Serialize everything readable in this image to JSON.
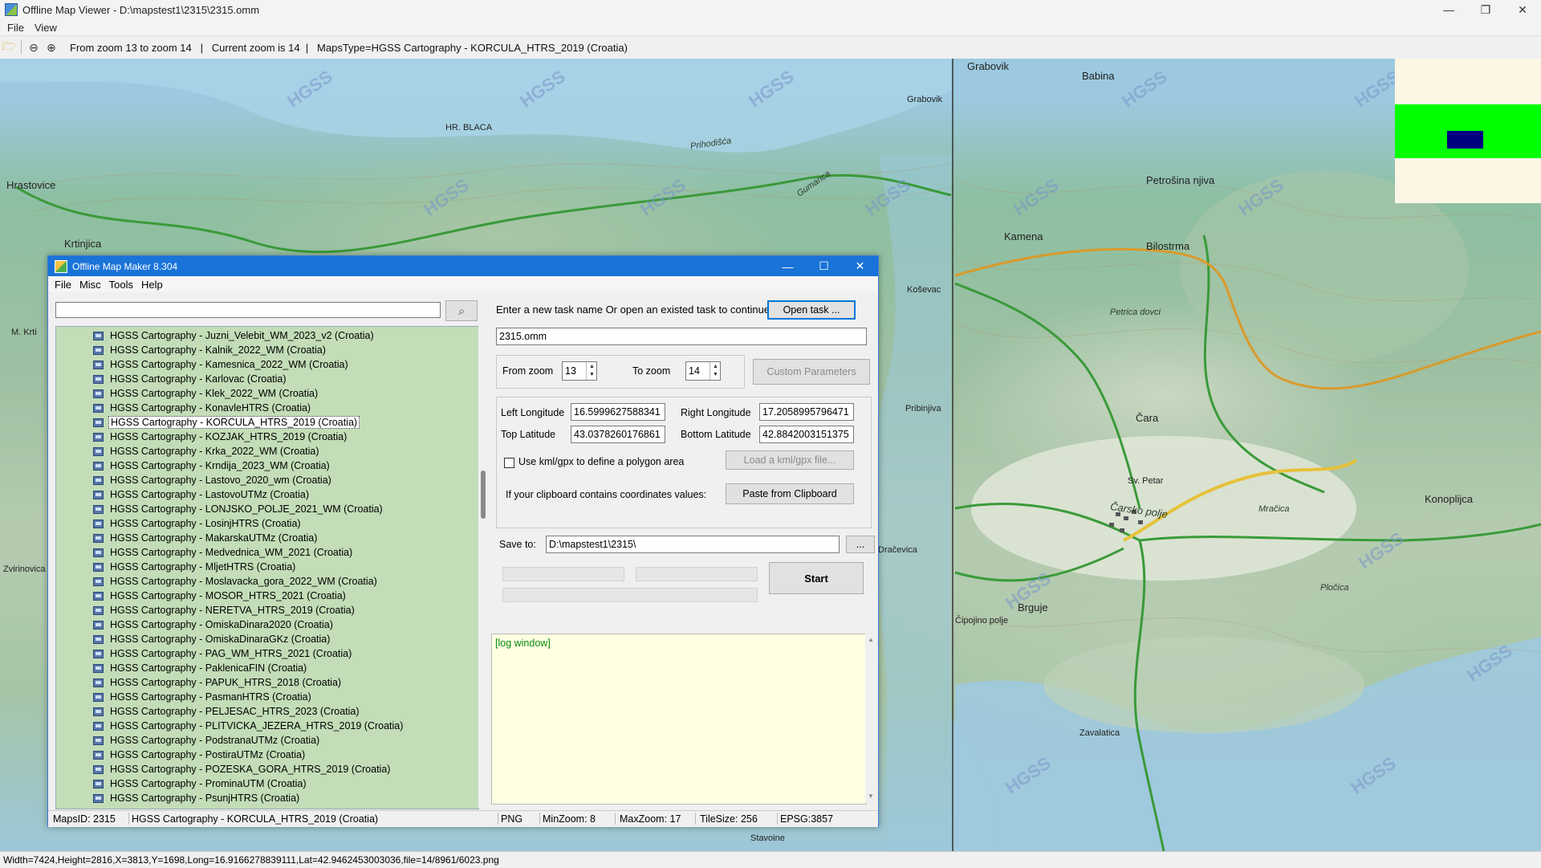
{
  "window": {
    "title": "Offline Map Viewer - D:\\mapstest1\\2315\\2315.omm",
    "controls": {
      "minimize": "—",
      "restore": "❐",
      "close": "✕"
    }
  },
  "menubar": {
    "items": [
      "File",
      "View"
    ]
  },
  "toolbar": {
    "zoom_range": "From zoom 13 to zoom 14   |   Current zoom is 14  |   MapsType=HGSS Cartography - KORCULA_HTRS_2019 (Croatia)"
  },
  "map": {
    "labels": [
      {
        "text": "Grabovik",
        "cls": "big"
      },
      {
        "text": "Grabovik",
        "cls": ""
      },
      {
        "text": "Babina",
        "cls": "big"
      },
      {
        "text": "Petrošina njiva",
        "cls": "big"
      },
      {
        "text": "Kamena",
        "cls": "big"
      },
      {
        "text": "Bilostrma",
        "cls": "big"
      },
      {
        "text": "Petrica dovci",
        "cls": "it"
      },
      {
        "text": "Hrastovice",
        "cls": "big"
      },
      {
        "text": "Krtinjica",
        "cls": "big"
      },
      {
        "text": "HR. BLACA",
        "cls": ""
      },
      {
        "text": "Prihodišća",
        "cls": "it"
      },
      {
        "text": "Gumanca",
        "cls": "it"
      },
      {
        "text": "Čara",
        "cls": "big"
      },
      {
        "text": "Konoplijca",
        "cls": "big"
      },
      {
        "text": "Čarsko polje",
        "cls": "it big"
      },
      {
        "text": "Brguje",
        "cls": "big"
      },
      {
        "text": "Zavalatica",
        "cls": ""
      },
      {
        "text": "Čipojino polje",
        "cls": ""
      },
      {
        "text": "Pribinjiva",
        "cls": ""
      },
      {
        "text": "Koševac",
        "cls": ""
      },
      {
        "text": "Dračevica",
        "cls": ""
      },
      {
        "text": "Stavoine",
        "cls": ""
      },
      {
        "text": "Sv. Petar",
        "cls": ""
      },
      {
        "text": "Mračica",
        "cls": "it"
      },
      {
        "text": "Pločica",
        "cls": "it"
      },
      {
        "text": "Zvirinovica",
        "cls": ""
      },
      {
        "text": "M. Krti",
        "cls": ""
      }
    ],
    "watermark": "HGSS"
  },
  "statusbar": {
    "text": "Width=7424,Height=2816,X=3813,Y=1698,Long=16.9166278839111,Lat=42.9462453003036,file=14/8961/6023.png"
  },
  "dialog": {
    "title": "Offline Map Maker 8.304",
    "controls": {
      "minimize": "—",
      "maximize": "☐",
      "close": "✕"
    },
    "menu": [
      "File",
      "Misc",
      "Tools",
      "Help"
    ],
    "search": {
      "value": "",
      "icon": "search-icon"
    },
    "map_list": [
      "HGSS Cartography - Juzni_Velebit_WM_2023_v2 (Croatia)",
      "HGSS Cartography - Kalnik_2022_WM (Croatia)",
      "HGSS Cartography - Kamesnica_2022_WM (Croatia)",
      "HGSS Cartography - Karlovac (Croatia)",
      "HGSS Cartography - Klek_2022_WM (Croatia)",
      "HGSS Cartography - KonavleHTRS (Croatia)",
      "HGSS Cartography - KORCULA_HTRS_2019 (Croatia)",
      "HGSS Cartography - KOZJAK_HTRS_2019 (Croatia)",
      "HGSS Cartography - Krka_2022_WM (Croatia)",
      "HGSS Cartography - Krndija_2023_WM (Croatia)",
      "HGSS Cartography - Lastovo_2020_wm (Croatia)",
      "HGSS Cartography - LastovoUTMz (Croatia)",
      "HGSS Cartography - LONJSKO_POLJE_2021_WM (Croatia)",
      "HGSS Cartography - LosinjHTRS (Croatia)",
      "HGSS Cartography - MakarskaUTMz (Croatia)",
      "HGSS Cartography - Medvednica_WM_2021 (Croatia)",
      "HGSS Cartography - MljetHTRS (Croatia)",
      "HGSS Cartography - Moslavacka_gora_2022_WM (Croatia)",
      "HGSS Cartography - MOSOR_HTRS_2021 (Croatia)",
      "HGSS Cartography - NERETVA_HTRS_2019 (Croatia)",
      "HGSS Cartography - OmiskaDinara2020 (Croatia)",
      "HGSS Cartography - OmiskaDinaraGKz (Croatia)",
      "HGSS Cartography - PAG_WM_HTRS_2021 (Croatia)",
      "HGSS Cartography - PaklenicaFIN (Croatia)",
      "HGSS Cartography - PAPUK_HTRS_2018 (Croatia)",
      "HGSS Cartography - PasmanHTRS (Croatia)",
      "HGSS Cartography - PELJESAC_HTRS_2023 (Croatia)",
      "HGSS Cartography - PLITVICKA_JEZERA_HTRS_2019 (Croatia)",
      "HGSS Cartography - PodstranaUTMz (Croatia)",
      "HGSS Cartography - PostiraUTMz (Croatia)",
      "HGSS Cartography - POZESKA_GORA_HTRS_2019 (Croatia)",
      "HGSS Cartography - ProminaUTM (Croatia)",
      "HGSS Cartography - PsunjHTRS (Croatia)"
    ],
    "selected_item": "HGSS Cartography - KORCULA_HTRS_2019 (Croatia)",
    "task_prompt": "Enter a new task name Or open an existed task to continue:",
    "open_task_label": "Open task ...",
    "task_name": "2315.omm",
    "from_zoom_label": "From zoom",
    "from_zoom": "13",
    "to_zoom_label": "To zoom",
    "to_zoom": "14",
    "custom_params_label": "Custom Parameters",
    "left_lon_label": "Left Longitude",
    "left_lon": "16.5999627588341",
    "right_lon_label": "Right Longitude",
    "right_lon": "17.2058995796471",
    "top_lat_label": "Top Latitude",
    "top_lat": "43.0378260176861",
    "bottom_lat_label": "Bottom Latitude",
    "bottom_lat": "42.8842003151375",
    "kml_checkbox_label": "Use kml/gpx to define a polygon area",
    "load_kml_label": "Load a kml/gpx file...",
    "clipboard_prompt": "If your clipboard contains coordinates values:",
    "paste_label": "Paste from Clipboard",
    "save_to_label": "Save to:",
    "save_to": "D:\\mapstest1\\2315\\",
    "browse_label": "...",
    "start_label": "Start",
    "log_text": "[log window]",
    "status": {
      "maps_id": "MapsID: 2315",
      "map_name": "HGSS Cartography - KORCULA_HTRS_2019 (Croatia)",
      "format": "PNG",
      "min_zoom": "MinZoom: 8",
      "max_zoom": "MaxZoom: 17",
      "tile_size": "TileSize: 256",
      "epsg": "EPSG:3857"
    }
  },
  "colors": {
    "dialog_title": "#1a73d8",
    "list_bg": "#c2ddb7",
    "log_bg": "#ffffe1",
    "road_yellow": "#e7c13a",
    "road_green": "#3a9a3a",
    "road_orange": "#d99a2b"
  }
}
